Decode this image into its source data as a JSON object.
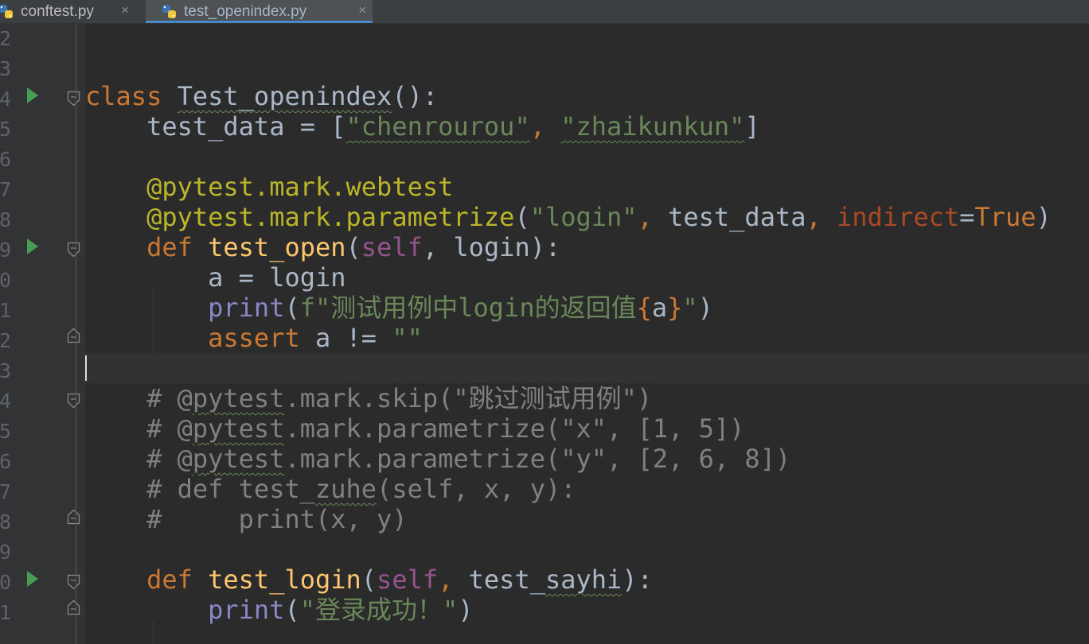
{
  "tabs": [
    {
      "label": "conftest.py",
      "active": false,
      "icon": "python-file-icon"
    },
    {
      "label": "test_openindex.py",
      "active": true,
      "icon": "python-file-icon"
    }
  ],
  "close_glyph": "×",
  "line_numbers": [
    "2",
    "3",
    "4",
    "5",
    "6",
    "7",
    "8",
    "9",
    "0",
    "1",
    "2",
    "3",
    "4",
    "5",
    "6",
    "7",
    "8",
    "9",
    "0",
    "1"
  ],
  "code": {
    "class_kw": "class",
    "class_name": "Test_openindex",
    "class_tail": "():",
    "test_data_var": "test_data",
    "eq": " = ",
    "list_open": "[",
    "str_chenrourou": "\"chenrourou\"",
    "comma": ", ",
    "str_zhaikunkun": "\"zhaikunkun\"",
    "list_close": "]",
    "deco_webtest": "@pytest.mark.webtest",
    "deco_parametrize": "@pytest.mark.parametrize",
    "paren_open": "(",
    "str_login": "\"login\"",
    "indirect_kw": "indirect",
    "eq_sign": "=",
    "true_kw": "True",
    "paren_close": ")",
    "def_kw": "def",
    "fn_test_open": "test_open",
    "self_kw": "self",
    "login_param": ", login):",
    "assign_line": "a = login",
    "print_fn": "print",
    "fstr_prefix": "f\"测试用例中login的返回值",
    "brace_open": "{",
    "fvar": "a",
    "brace_close": "}",
    "fstr_end": "\"",
    "assert_kw": "assert",
    "assert_rest": " a != ",
    "empty_str": "\"\"",
    "c1_hash": "# @",
    "c_pytest": "pytest",
    "c1_rest": ".mark.skip(\"跳过测试用例\")",
    "c2_rest": ".mark.parametrize(\"x\", [1, 5])",
    "c3_rest": ".mark.parametrize(\"y\", [2, 6, 8])",
    "c4_pre": "# def test_",
    "c4_zuhe": "zuhe",
    "c4_rest": "(self, x, y):",
    "c5": "#     print(x, y)",
    "fn_test_login": "test_login",
    "test_pre": "test_",
    "sayhi": "sayhi",
    "tail_close": "):",
    "str_success": "\"登录成功！\"",
    "colon": ":"
  },
  "colors": {
    "background": "#2b2b2b",
    "keyword": "#cc7832",
    "function": "#ffc66d",
    "string": "#6a8759",
    "decorator": "#bbb529",
    "self": "#94558d",
    "builtin": "#8888c6",
    "comment": "#808080",
    "run_arrow": "#499c54"
  }
}
